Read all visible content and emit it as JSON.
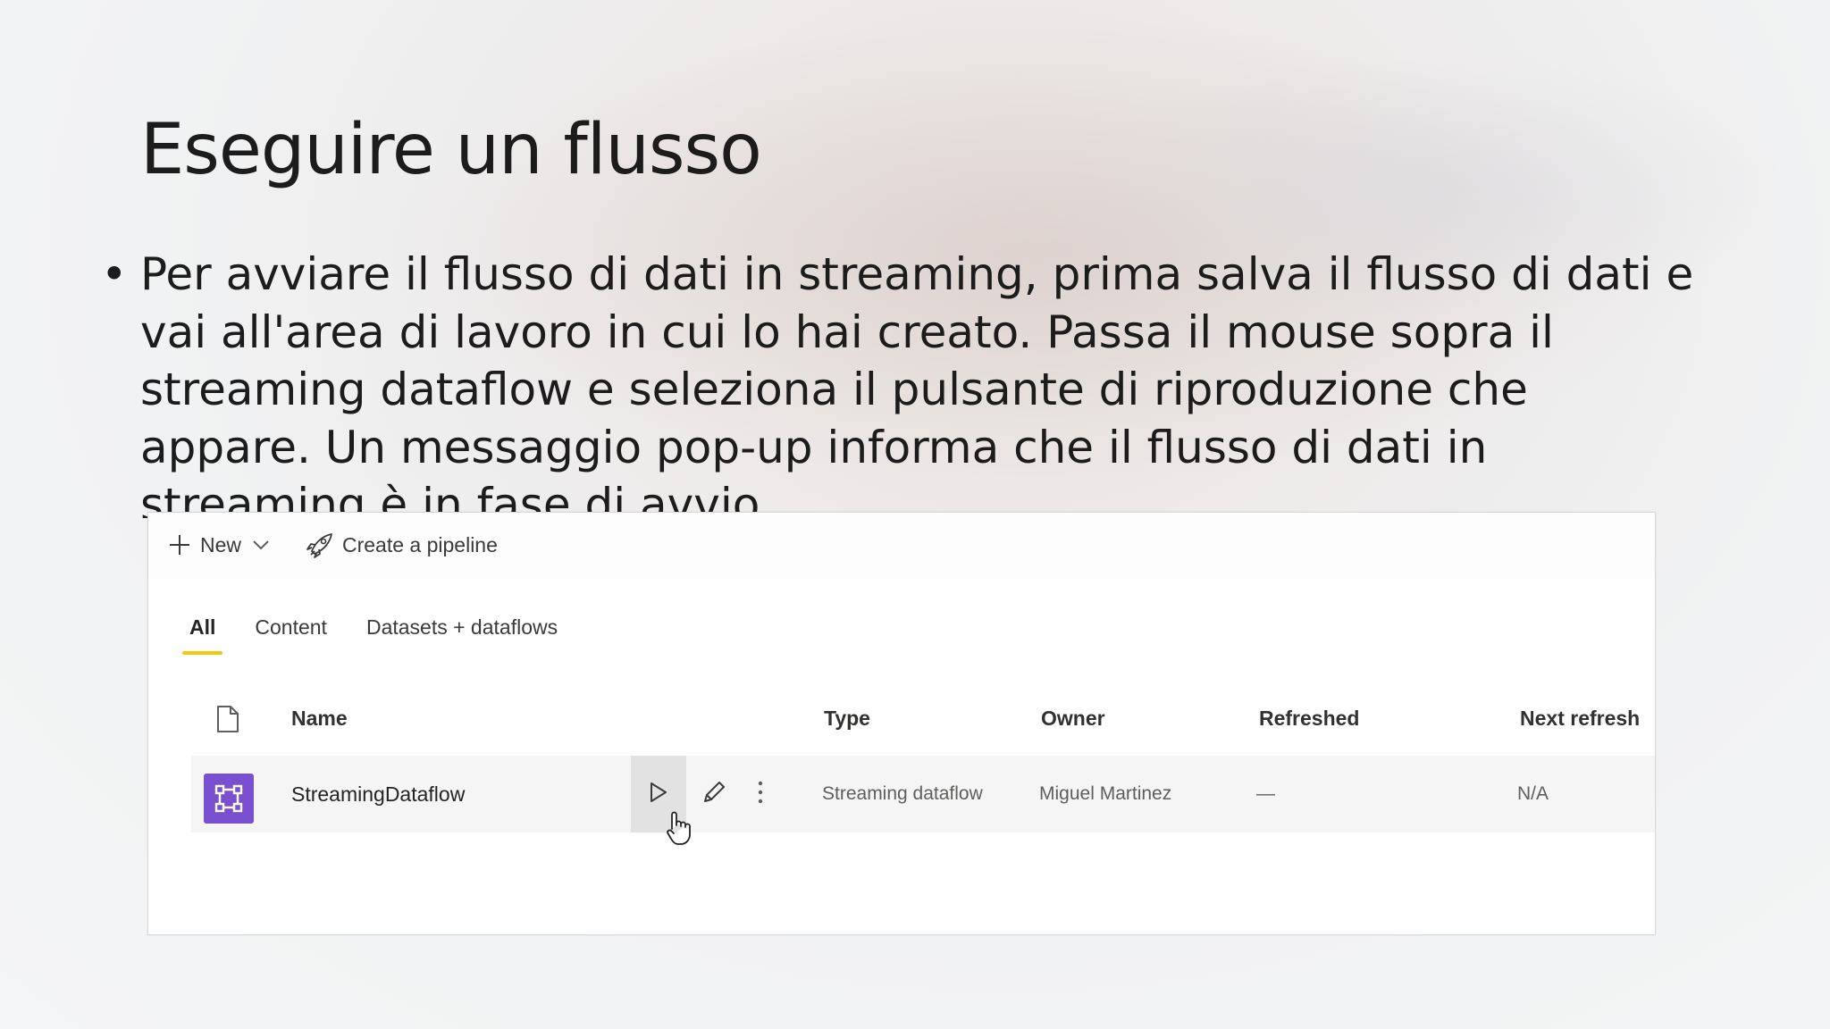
{
  "slide": {
    "title": "Eseguire un flusso",
    "bullet": "Per avviare il flusso di dati in streaming, prima salva il flusso di dati e vai all'area di lavoro in cui lo hai creato. Passa il mouse sopra il streaming dataflow  e seleziona il pulsante di riproduzione che appare. Un messaggio pop-up informa che il flusso di dati in streaming è in fase di avvio."
  },
  "toolbar": {
    "new_label": "New",
    "pipeline_label": "Create a pipeline"
  },
  "tabs": [
    "All",
    "Content",
    "Datasets + dataflows"
  ],
  "table": {
    "headers": {
      "name": "Name",
      "type": "Type",
      "owner": "Owner",
      "refreshed": "Refreshed",
      "next_refresh": "Next refresh"
    },
    "rows": [
      {
        "name": "StreamingDataflow",
        "type": "Streaming dataflow",
        "owner": "Miguel Martinez",
        "refreshed": "—",
        "next_refresh": "N/A"
      }
    ]
  },
  "colors": {
    "tab_underline": "#f2c811",
    "dataflow_icon": "#7a4fd0"
  },
  "icons": [
    "plus-icon",
    "chevron-down-icon",
    "rocket-icon",
    "file-icon",
    "dataflow-icon",
    "play-icon",
    "pencil-icon",
    "more-icon",
    "hand-cursor-icon"
  ]
}
